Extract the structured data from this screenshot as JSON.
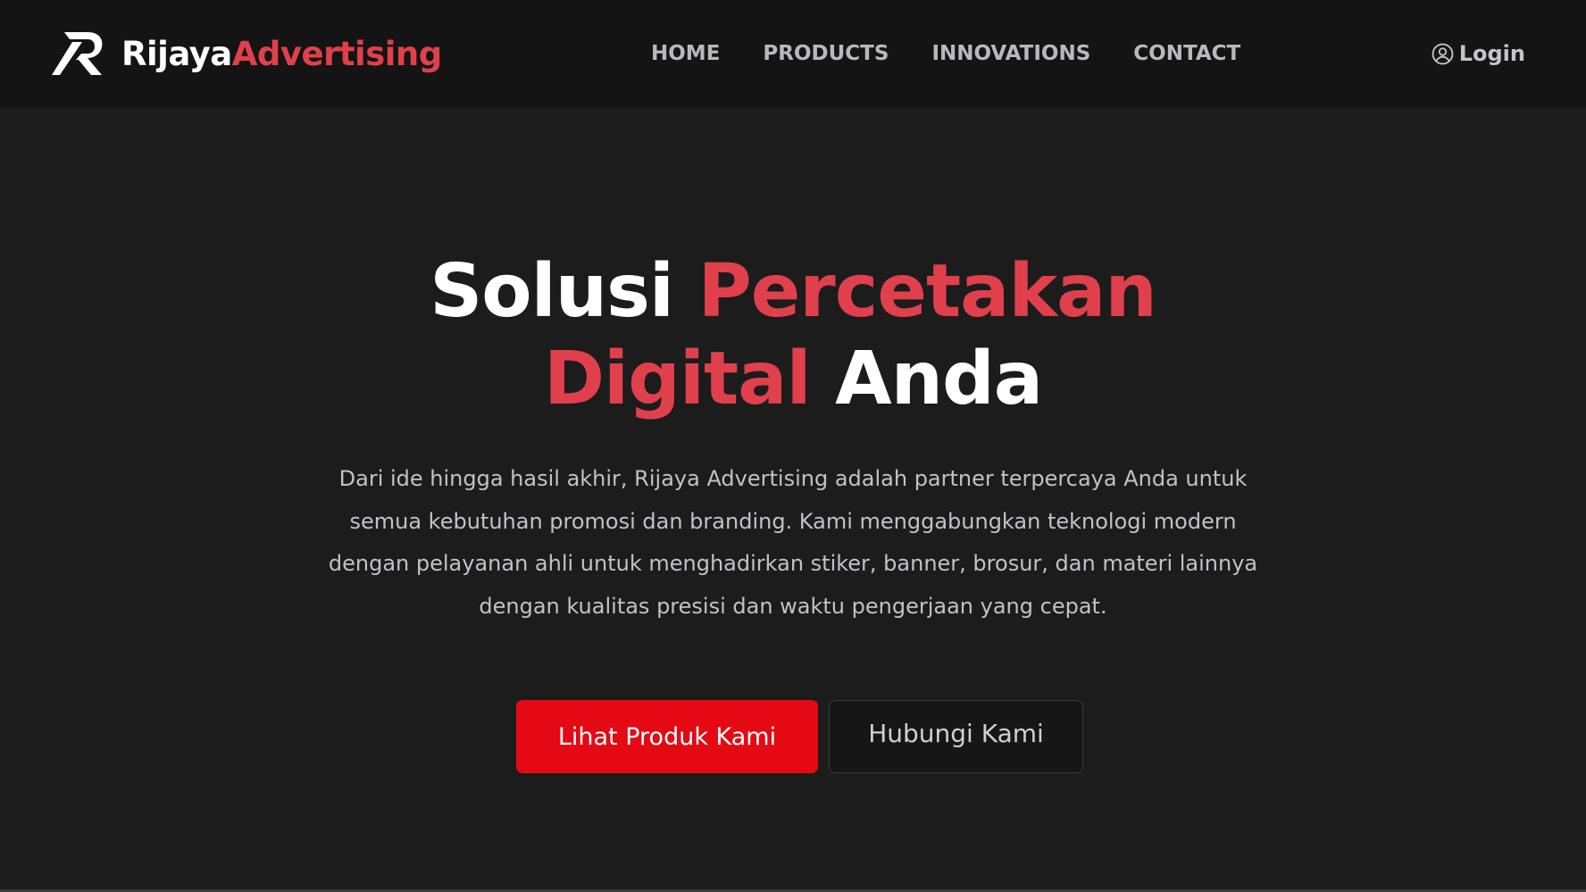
{
  "brand": {
    "name_part1": "Rijaya",
    "name_part2": "Advertising",
    "logo_icon": "r-monogram-logo"
  },
  "nav": {
    "links": [
      {
        "label": "HOME"
      },
      {
        "label": "PRODUCTS"
      },
      {
        "label": "INNOVATIONS"
      },
      {
        "label": "CONTACT"
      }
    ],
    "login_label": "Login",
    "login_icon": "user-circle-icon"
  },
  "hero": {
    "title_1": "Solusi",
    "title_2": "Percetakan",
    "title_3": "Digital",
    "title_4": "Anda",
    "description": "Dari ide hingga hasil akhir, Rijaya Advertising adalah partner terpercaya Anda untuk semua kebutuhan promosi dan branding. Kami menggabungkan teknologi modern dengan pelayanan ahli untuk menghadirkan stiker, banner, brosur, dan materi lainnya dengan kualitas presisi dan waktu pengerjaan yang cepat.",
    "primary_button": "Lihat Produk Kami",
    "secondary_button": "Hubungi Kami"
  },
  "colors": {
    "page_background": "#1c1c1d",
    "navbar_background": "#141414",
    "accent": "#e0404c",
    "primary_button": "#e50914"
  }
}
